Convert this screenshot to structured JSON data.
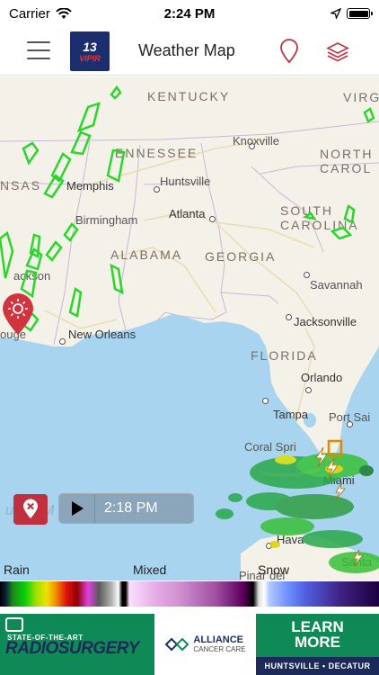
{
  "status_bar": {
    "carrier": "Carrier",
    "time": "2:24 PM"
  },
  "nav": {
    "logo_number": "13",
    "logo_text": "VIPIR",
    "title": "Weather Map"
  },
  "map": {
    "states": {
      "kentucky": "KENTUCKY",
      "virginia": "VIRGI",
      "tennessee": "ENNESSEE",
      "north_carolina": "NORTH\nCAROL",
      "arkansas": "NSAS",
      "south_carolina": "SOUTH\nCAROLINA",
      "alabama": "ALABAMA",
      "georgia": "GEORGIA",
      "florida": "FLORIDA"
    },
    "cities": {
      "knoxville": "Knoxville",
      "memphis": "Memphis",
      "huntsville": "Huntsville",
      "birmingham": "Birmingham",
      "atlanta": "Atlanta",
      "jackson": "ackson",
      "savannah": "Savannah",
      "jacksonville": "Jacksonville",
      "new_orleans": "New Orleans",
      "baton_rouge": "ouge",
      "orlando": "Orlando",
      "tampa": "Tampa",
      "port_saint_lucie": "Port Sai",
      "coral_springs": "Coral Spri",
      "miami": "Miami",
      "havana": "Hava",
      "santa_clara": "Santa",
      "pinar_del_rio": "Pinar del"
    },
    "gulf_label": "u of M"
  },
  "playback": {
    "time": "2:18 PM"
  },
  "legend": {
    "rain": "Rain",
    "mixed": "Mixed",
    "snow": "Snow"
  },
  "ad": {
    "tagline": "STATE-OF-THE-ART",
    "headline": "RADIOSURGERY",
    "brand": "ALLIANCE",
    "brand_sub": "CANCER CARE",
    "cta": "LEARN MORE",
    "locations": "HUNTSVILLE • DECATUR"
  },
  "colors": {
    "accent": "#c0303f",
    "ad_green": "#0f8a56",
    "ad_navy": "#1c2a5a",
    "water": "#a9d4ef",
    "land": "#f4f1e8"
  }
}
